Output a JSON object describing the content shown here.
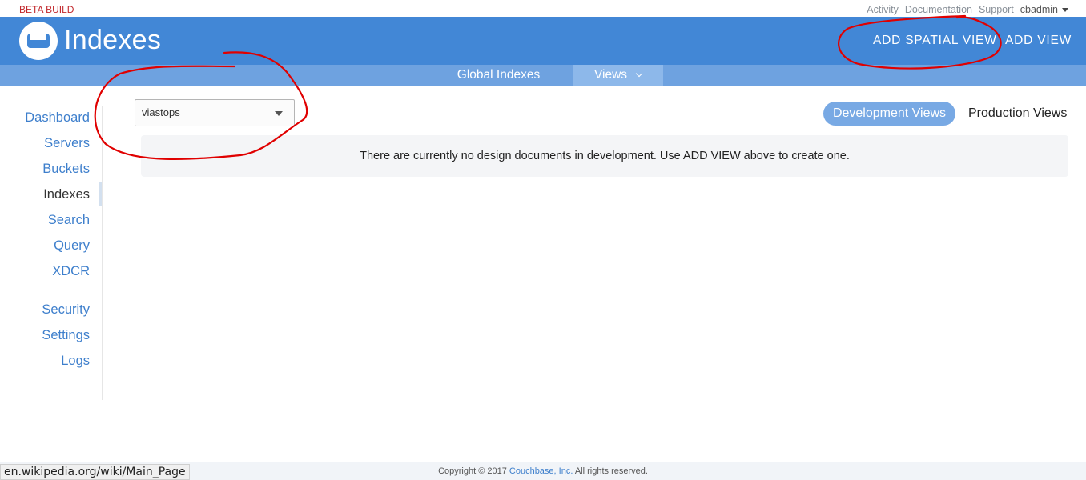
{
  "topbar": {
    "beta_label": "BETA BUILD",
    "links": [
      "Activity",
      "Documentation",
      "Support"
    ],
    "user": "cbadmin"
  },
  "header": {
    "title": "Indexes",
    "add_spatial_view": "ADD SPATIAL VIEW",
    "add_view": "ADD VIEW"
  },
  "subnav": {
    "tabs": [
      {
        "label": "Global Indexes"
      },
      {
        "label": "Views"
      }
    ]
  },
  "sidebar": {
    "items": [
      {
        "label": "Dashboard"
      },
      {
        "label": "Servers"
      },
      {
        "label": "Buckets"
      },
      {
        "label": "Indexes"
      },
      {
        "label": "Search"
      },
      {
        "label": "Query"
      },
      {
        "label": "XDCR"
      },
      {
        "label": "Security"
      },
      {
        "label": "Settings"
      },
      {
        "label": "Logs"
      }
    ],
    "active": "Indexes"
  },
  "main": {
    "bucket_selected": "viastops",
    "view_toggle": {
      "development": "Development Views",
      "production": "Production Views",
      "active": "development"
    },
    "empty_message": "There are currently no design documents in development. Use ADD VIEW above to create one."
  },
  "footer": {
    "copyright_prefix": "Copyright © 2017",
    "company": "Couchbase, Inc.",
    "copyright_suffix": "All rights reserved."
  },
  "status_bar": {
    "url": "en.wikipedia.org/wiki/Main_Page"
  },
  "colors": {
    "brand_blue": "#4287d6",
    "subnav_blue": "#6ea2e0",
    "link_blue": "#3e7fcc",
    "beta_red": "#c2282c",
    "annotation_red": "#e00000"
  }
}
